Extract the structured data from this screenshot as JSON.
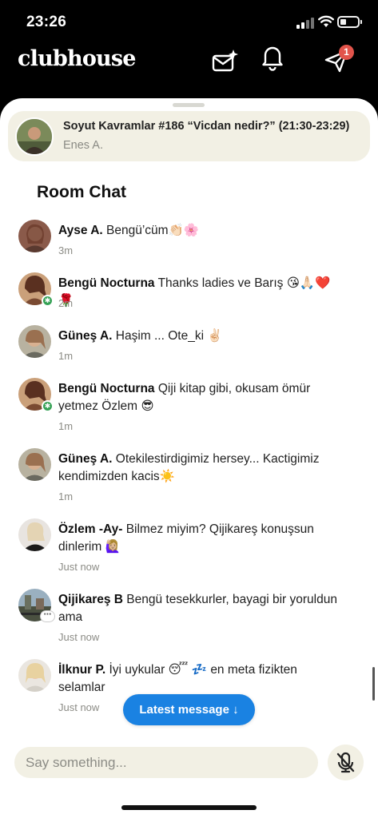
{
  "status": {
    "time": "23:26"
  },
  "header": {
    "brand": "clubhouse",
    "notification_count": "1"
  },
  "room": {
    "title": "Soyut Kavramlar #186 “Vicdan nedir?” (21:30-23:29)",
    "host": "Enes A."
  },
  "chat": {
    "heading": "Room Chat",
    "messages": [
      {
        "name": "Ayse A.",
        "text": " Bengü’cüm👏🏻🌸",
        "time": "3m"
      },
      {
        "name": "Bengü Nocturna",
        "text": " Thanks ladies ve Barış 😘🙏🏻❤️🌹",
        "time": "2m"
      },
      {
        "name": "Güneş A.",
        "text": " Haşim ... Ote_ki ✌🏻",
        "time": "1m"
      },
      {
        "name": "Bengü Nocturna",
        "text": " Qiji kitap gibi, okusam ömür yetmez Özlem 😎",
        "time": "1m"
      },
      {
        "name": "Güneş A.",
        "text": " Otekilestirdigimiz hersey... Kactigimiz kendimizden kacis☀️",
        "time": "1m"
      },
      {
        "name": "Özlem -Ay-",
        "text": " Bilmez miyim? Qijikareş konuşsun dinlerim 🙋🏼‍♀️",
        "time": "Just now"
      },
      {
        "name": "Qijikareş B",
        "text": " Bengü tesekkurler, bayagi bir yoruldun ama",
        "time": "Just now"
      },
      {
        "name": "İlknur P.",
        "text": " İyi uykular 😴 💤  en meta fizikten selamlar",
        "time": "Just now"
      }
    ]
  },
  "latest_button": "Latest message ↓",
  "composer": {
    "placeholder": "Say something..."
  },
  "colors": {
    "accent": "#1a82e2",
    "banner": "#f2f0e4",
    "badge": "#e2544b",
    "moderator": "#35a155"
  }
}
